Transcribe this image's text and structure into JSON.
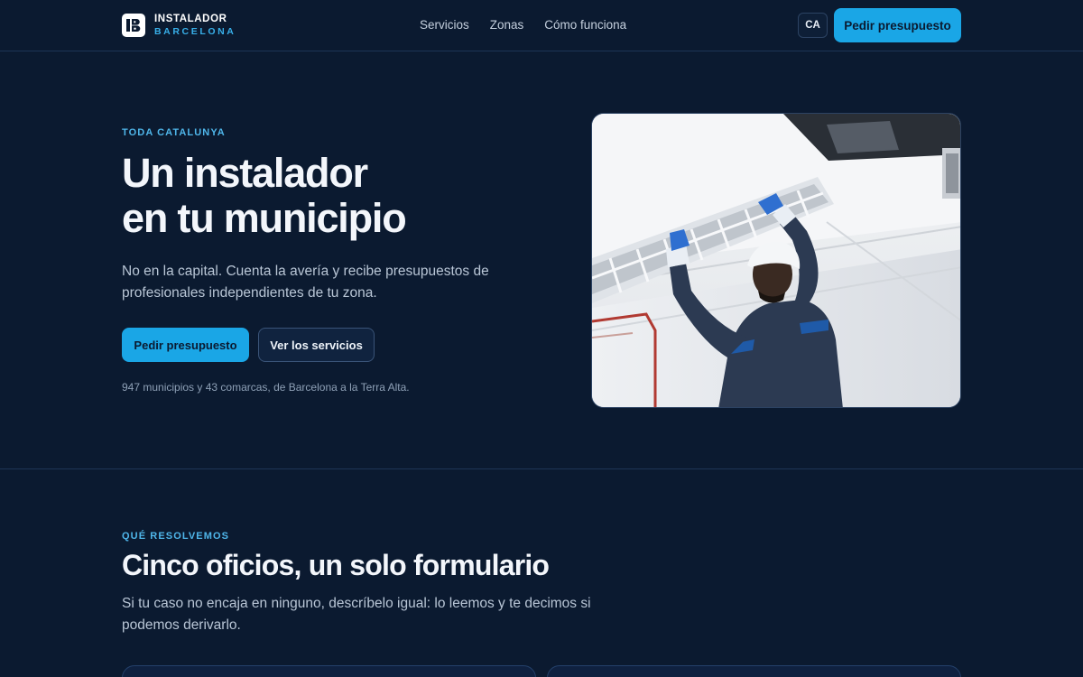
{
  "header": {
    "logo_line1": "INSTALADOR",
    "logo_line2": "BARCELONA",
    "nav": [
      "Servicios",
      "Zonas",
      "Cómo funciona"
    ],
    "lang": "CA",
    "cta": "Pedir presupuesto"
  },
  "hero": {
    "eyebrow": "TODA CATALUNYA",
    "title_line1": "Un instalador",
    "title_line2": "en tu municipio",
    "description": "No en la capital. Cuenta la avería y recibe presupuestos de profesionales independientes de tu zona.",
    "primary_button": "Pedir presupuesto",
    "secondary_button": "Ver los servicios",
    "note": "947 municipios y 43 comarcas, de Barcelona a la Terra Alta."
  },
  "services": {
    "eyebrow": "QUÉ RESOLVEMOS",
    "title": "Cinco oficios, un solo formulario",
    "description": "Si tu caso no encaja en ninguno, descríbelo igual: lo leemos y te decimos si podemos derivarlo."
  },
  "colors": {
    "background": "#0b1a30",
    "accent": "#1aa6e6",
    "eyebrow": "#4fb6ea",
    "border": "#1e3556"
  },
  "icons": {
    "logo": "logo-mark-icon",
    "hero_image": "electrician-installing-ceiling-light-photo"
  }
}
